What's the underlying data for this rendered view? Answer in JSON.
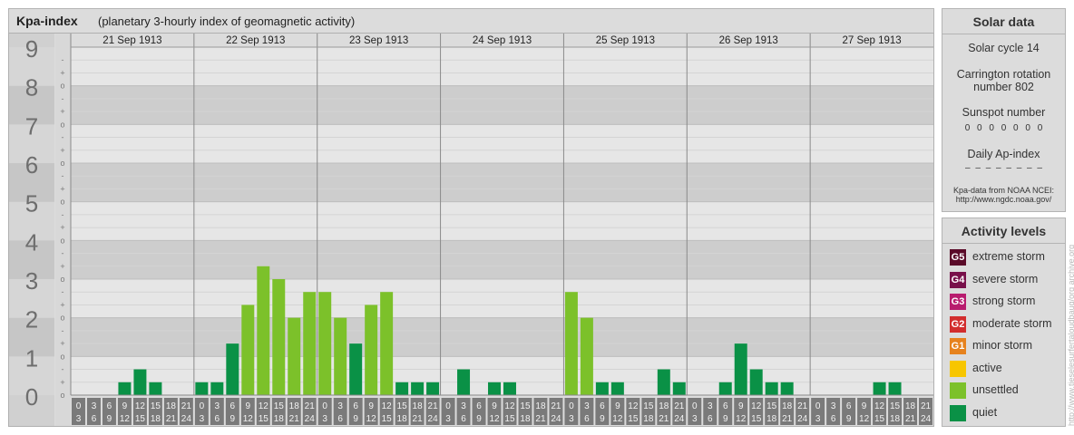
{
  "title": {
    "main": "Kpa-index",
    "sub": "(planetary 3-hourly index of geomagnetic activity)"
  },
  "chart_data": {
    "type": "bar",
    "title": "Kpa-index",
    "subtitle": "(planetary 3-hourly index of geomagnetic activity)",
    "ylim": [
      0,
      9
    ],
    "y_ticks": [
      "0",
      "1",
      "2",
      "3",
      "4",
      "5",
      "6",
      "7",
      "8",
      "9"
    ],
    "y_minor_marks": [
      "o",
      "+",
      "-"
    ],
    "days": [
      "21 Sep 1913",
      "22 Sep 1913",
      "23 Sep 1913",
      "24 Sep 1913",
      "25 Sep 1913",
      "26 Sep 1913",
      "27 Sep 1913"
    ],
    "slot_start_hours": [
      "0",
      "3",
      "6",
      "9",
      "12",
      "15",
      "18",
      "21"
    ],
    "slot_end_hours": [
      "3",
      "6",
      "9",
      "12",
      "15",
      "18",
      "21",
      "24"
    ],
    "values": [
      [
        0,
        0,
        0,
        0.333,
        0.667,
        0.333,
        0,
        0
      ],
      [
        0.333,
        0.333,
        1.333,
        2.333,
        3.333,
        3,
        2,
        2.667
      ],
      [
        2.667,
        2,
        1.333,
        2.333,
        2.667,
        0.333,
        0.333,
        0.333
      ],
      [
        0,
        0.667,
        0,
        0.333,
        0.333,
        0,
        0,
        0
      ],
      [
        2.667,
        2,
        0.333,
        0.333,
        0,
        0,
        0.667,
        0.333
      ],
      [
        0,
        0,
        0.333,
        1.333,
        0.667,
        0.333,
        0.333,
        0
      ],
      [
        0,
        0,
        0,
        0,
        0.333,
        0.333,
        0,
        0
      ]
    ],
    "colors": {
      "quiet": "#0a9146",
      "unsettled": "#7cc12a",
      "active": "#f7c600"
    },
    "grid": true,
    "legend": "right"
  },
  "solar": {
    "header": "Solar data",
    "cycle": "Solar cycle 14",
    "carrington_1": "Carrington rotation",
    "carrington_2": "number 802",
    "sunspot_label": "Sunspot number",
    "sunspot_values": "0 0 0 0 0 0 0",
    "ap_label": "Daily Ap-index",
    "ap_values": "– – – – – – – –",
    "source_1": "Kpa-data from NOAA NCEI:",
    "source_2": "http://www.ngdc.noaa.gov/"
  },
  "levels": {
    "header": "Activity levels",
    "items": [
      {
        "badge": "G5",
        "label": "extreme storm",
        "color": "#5a0a28"
      },
      {
        "badge": "G4",
        "label": "severe storm",
        "color": "#78104a"
      },
      {
        "badge": "G3",
        "label": "strong storm",
        "color": "#b81c6e"
      },
      {
        "badge": "G2",
        "label": "moderate storm",
        "color": "#d22d2d"
      },
      {
        "badge": "G1",
        "label": "minor storm",
        "color": "#e6821e"
      },
      {
        "badge": "",
        "label": "active",
        "color": "#f7c600"
      },
      {
        "badge": "",
        "label": "unsettled",
        "color": "#7cc12a"
      },
      {
        "badge": "",
        "label": "quiet",
        "color": "#0a9146"
      }
    ]
  },
  "credit": "http://www.tieselesurfertaloudbaug/org  archive.org"
}
